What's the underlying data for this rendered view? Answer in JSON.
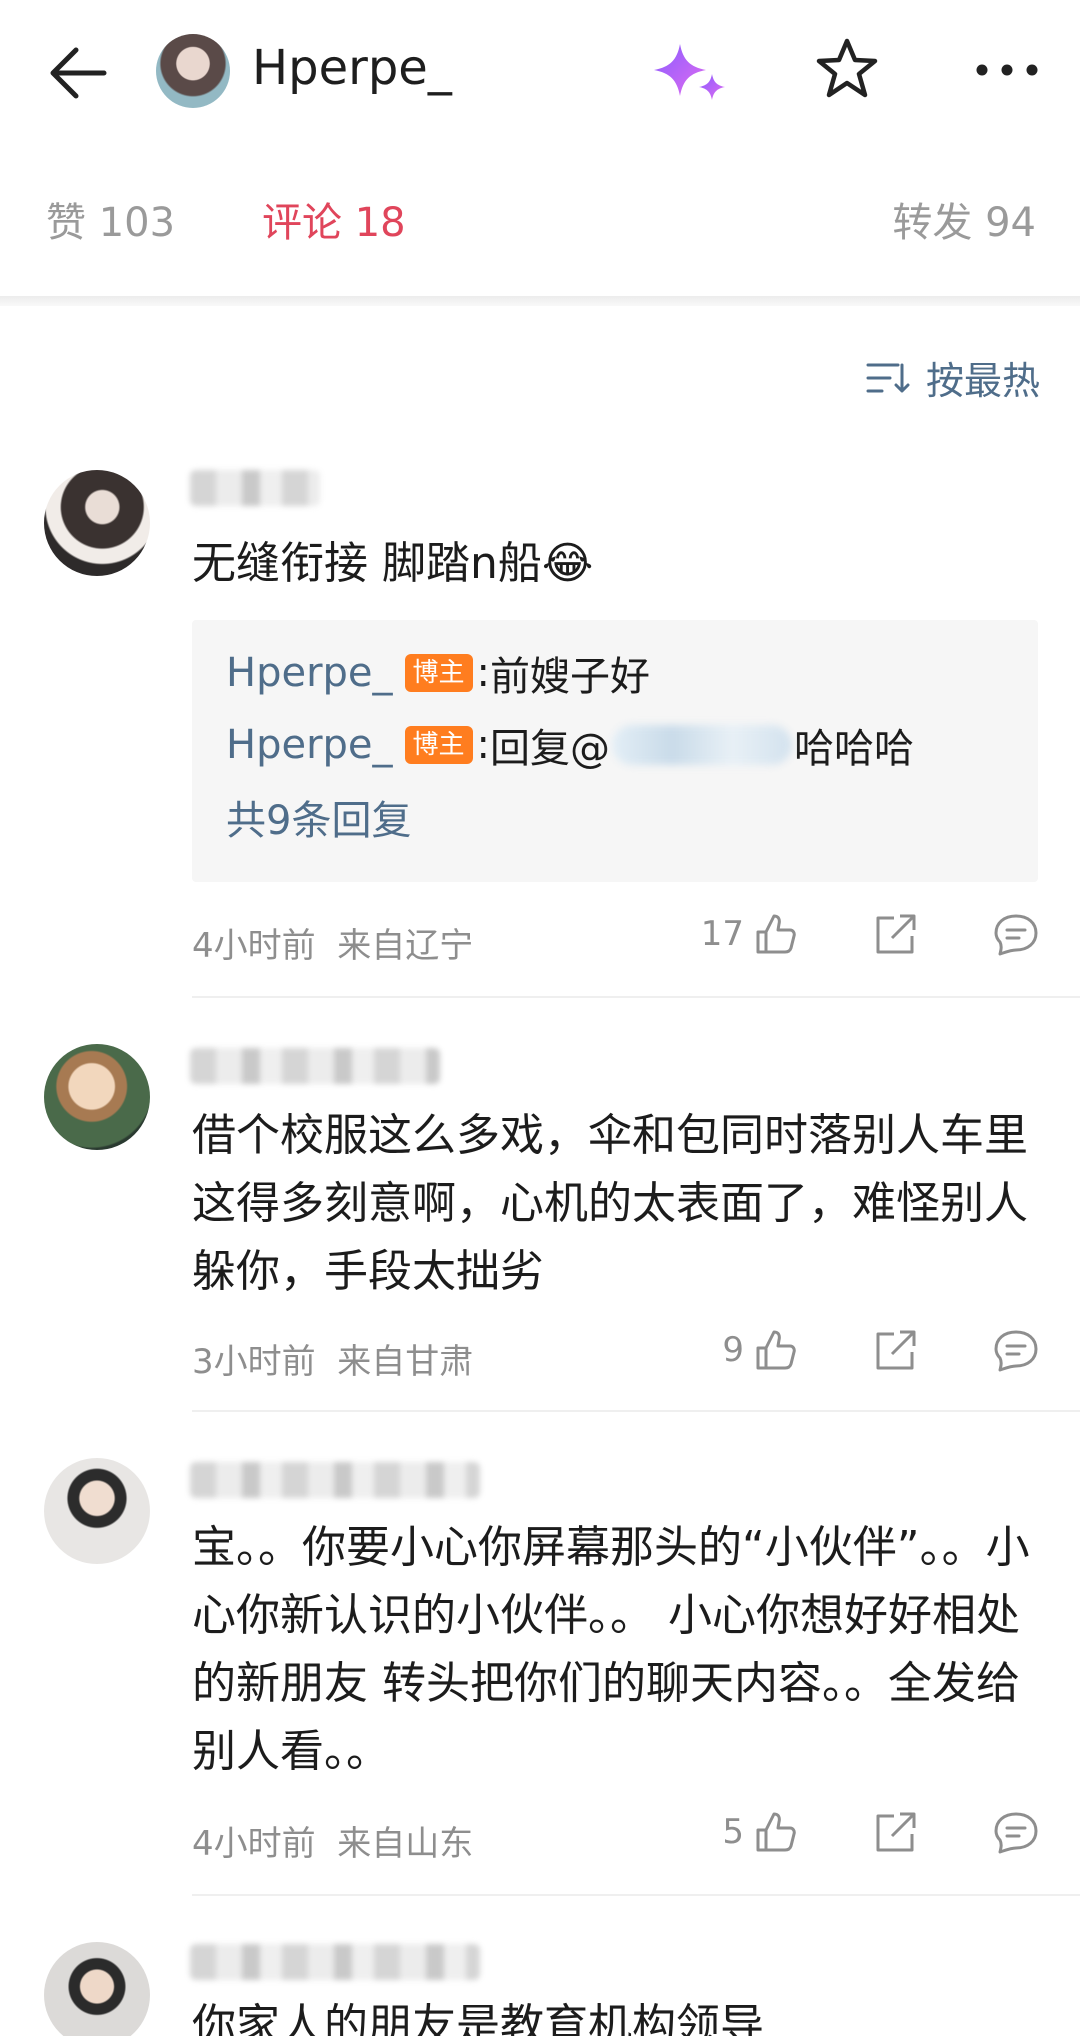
{
  "header": {
    "username": "Hperpe_"
  },
  "tabs": {
    "likes": "赞 103",
    "comments": "评论 18",
    "reposts": "转发 94"
  },
  "sort": {
    "label": "按最热"
  },
  "comments": [
    {
      "text": "无缝衔接 脚踏n船😂",
      "replies": [
        {
          "user": "Hperpe_",
          "badge": "博主",
          "sep": ": ",
          "text": "前嫂子好"
        },
        {
          "user": "Hperpe_",
          "badge": "博主",
          "sep": ": ",
          "prefix": "回复@",
          "text": "哈哈哈"
        }
      ],
      "reply_total": "共9条回复",
      "time": "4小时前",
      "location": "来自辽宁",
      "likes": "17"
    },
    {
      "text": "借个校服这么多戏，伞和包同时落别人车里这得多刻意啊，心机的太表面了，难怪别人躲你，手段太拙劣",
      "time": "3小时前",
      "location": "来自甘肃",
      "likes": "9"
    },
    {
      "text": "宝。。你要小心你屏幕那头的“小伙伴”。。小心你新认识的小伙伴。。 小心你想好好相处的新朋友 转头把你们的聊天内容。。全发给别人看。。",
      "time": "4小时前",
      "location": "来自山东",
      "likes": "5"
    },
    {
      "text": "你家人的朋友是教育机构领导"
    }
  ],
  "colors": {
    "accent": "#e0455b",
    "link": "#4f6d8a",
    "badge": "#ff7d1f"
  }
}
